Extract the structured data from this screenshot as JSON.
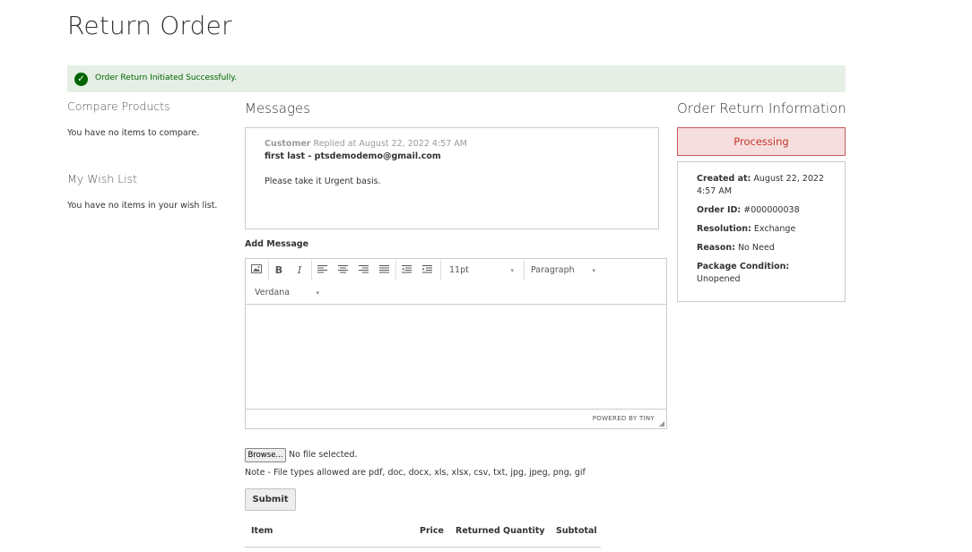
{
  "page": {
    "title": "Return Order"
  },
  "alert": {
    "message": "Order Return Initiated Successfully."
  },
  "sidebar": {
    "compare": {
      "title": "Compare Products",
      "empty": "You have no items to compare."
    },
    "wishlist": {
      "title": "My Wish List",
      "empty": "You have no items in your wish list."
    }
  },
  "messages": {
    "title": "Messages",
    "items": [
      {
        "author": "Customer",
        "replied": "Replied at August 22, 2022 4:57 AM",
        "from": "first last - ptsdemodemo@gmail.com",
        "text": "Please take it Urgent basis."
      }
    ]
  },
  "add_message": {
    "label": "Add Message",
    "editor": {
      "font_size": "11pt",
      "block_format": "Paragraph",
      "font_family": "Verdana",
      "powered_by": "POWERED BY TINY"
    },
    "browse_label": "Browse...",
    "no_file": "No file selected.",
    "note": "Note - File types allowed are pdf, doc, docx, xls, xlsx, csv, txt, jpg, jpeg, png, gif",
    "submit_label": "Submit"
  },
  "items_table": {
    "columns": [
      "Item",
      "Price",
      "Returned Quantity",
      "Subtotal"
    ]
  },
  "return_info": {
    "title": "Order Return Information",
    "status": "Processing",
    "fields": [
      {
        "label": "Created at:",
        "value": "August 22, 2022 4:57 AM"
      },
      {
        "label": "Order ID:",
        "value": "#000000038"
      },
      {
        "label": "Resolution:",
        "value": "Exchange"
      },
      {
        "label": "Reason:",
        "value": "No Need"
      },
      {
        "label": "Package Condition:",
        "value": "Unopened"
      }
    ]
  },
  "colors": {
    "success_bg": "#e5efe5",
    "success_text": "#006400",
    "status_bg": "#f7dede",
    "status_border": "#c85a5a"
  }
}
